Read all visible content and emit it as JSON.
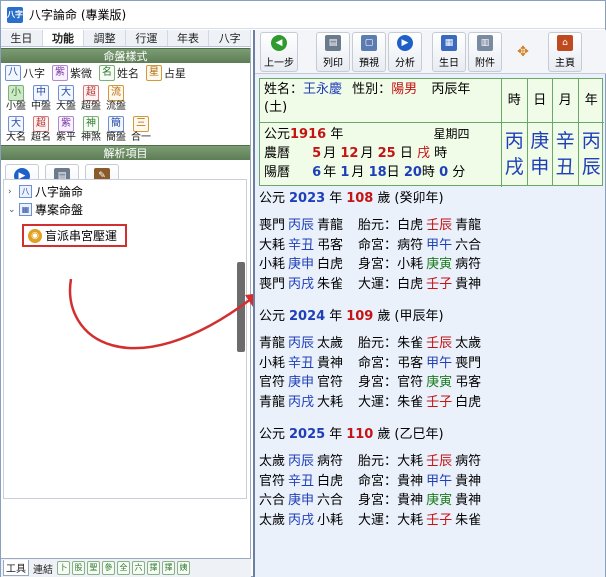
{
  "window": {
    "title": "八字論命 (專業版)",
    "icon_text": "八字"
  },
  "left_tabs": [
    "生日",
    "功能",
    "調整",
    "行運",
    "年表",
    "八字"
  ],
  "sections": {
    "chart_style": "命盤樣式",
    "analysis": "解析項目"
  },
  "style_row1": [
    {
      "icon": "八",
      "label": "八字"
    },
    {
      "icon": "紫",
      "label": "紫微"
    },
    {
      "icon": "名",
      "label": "姓名"
    },
    {
      "icon": "星",
      "label": "占星"
    }
  ],
  "style_row2": [
    {
      "icon": "小",
      "label": "小盤"
    },
    {
      "icon": "中",
      "label": "中盤"
    },
    {
      "icon": "大",
      "label": "大盤"
    },
    {
      "icon": "超",
      "label": "超盤"
    },
    {
      "icon": "流",
      "label": "流盤"
    }
  ],
  "style_row3": [
    {
      "icon": "大",
      "label": "大名"
    },
    {
      "icon": "超",
      "label": "超名"
    },
    {
      "icon": "紫",
      "label": "紫平"
    },
    {
      "icon": "神",
      "label": "神煞"
    },
    {
      "icon": "簡",
      "label": "簡盤"
    },
    {
      "icon": "三",
      "label": "合一"
    }
  ],
  "analysis_buttons": [
    "分析",
    "列印",
    "撰寫"
  ],
  "tree": {
    "root": "八字論命",
    "case": "專案命盤",
    "selected": "盲派串宮壓運"
  },
  "bottom_tabs": {
    "tools": "工具",
    "links": "連結",
    "minis": [
      "卜",
      "股",
      "聖",
      "參",
      "全",
      "六",
      "擇",
      "擇",
      "姨"
    ]
  },
  "toolbar": [
    "上一步",
    "列印",
    "預視",
    "分析",
    "生日",
    "附件",
    "",
    "主頁"
  ],
  "info": {
    "name_label": "姓名：",
    "name": "王永慶",
    "gender_label": "性別：",
    "gender": "陽男",
    "year_gz": "丙辰年",
    "year_wx": "(土)",
    "western_label": "公元",
    "western_year": "1916",
    "year_unit": "年",
    "weekday": "星期四",
    "lunar_label": "農曆",
    "lunar_month": "5",
    "lunar_day": "12",
    "lunar_hour": "25",
    "lunar_hour_unit": "日",
    "lunar_zhi": "戌",
    "hour_unit": "時",
    "solar_label": "陽曆",
    "solar_month": "6",
    "solar_day": "1",
    "solar_d2": "18",
    "solar_h": "20",
    "solar_m": "0",
    "pillars": [
      {
        "h": "時",
        "stem": "丙",
        "branch": "戌"
      },
      {
        "h": "日",
        "stem": "庚",
        "branch": "申"
      },
      {
        "h": "月",
        "stem": "辛",
        "branch": "丑"
      },
      {
        "h": "年",
        "stem": "丙",
        "branch": "辰"
      }
    ]
  },
  "years": [
    {
      "prefix": "公元",
      "year": "2023",
      "age": "108",
      "gz": "(癸卯年)",
      "rows": [
        [
          "喪門",
          "丙辰",
          "青龍",
          "胎元：",
          "白虎",
          "壬辰",
          "青龍"
        ],
        [
          "大耗",
          "辛丑",
          "弔客",
          "命宮：",
          "病符",
          "甲午",
          "六合"
        ],
        [
          "小耗",
          "庚申",
          "白虎",
          "身宮：",
          "小耗",
          "庚寅",
          "病符"
        ],
        [
          "喪門",
          "丙戌",
          "朱雀",
          "大運：",
          "白虎",
          "壬子",
          "貴神"
        ]
      ]
    },
    {
      "prefix": "公元",
      "year": "2024",
      "age": "109",
      "gz": "(甲辰年)",
      "rows": [
        [
          "青龍",
          "丙辰",
          "太歲",
          "胎元：",
          "朱雀",
          "壬辰",
          "太歲"
        ],
        [
          "小耗",
          "辛丑",
          "貴神",
          "命宮：",
          "弔客",
          "甲午",
          "喪門"
        ],
        [
          "官符",
          "庚申",
          "官符",
          "身宮：",
          "官符",
          "庚寅",
          "弔客"
        ],
        [
          "青龍",
          "丙戌",
          "大耗",
          "大運：",
          "朱雀",
          "壬子",
          "白虎"
        ]
      ]
    },
    {
      "prefix": "公元",
      "year": "2025",
      "age": "110",
      "gz": "(乙巳年)",
      "rows": [
        [
          "太歲",
          "丙辰",
          "病符",
          "胎元：",
          "大耗",
          "壬辰",
          "病符"
        ],
        [
          "官符",
          "辛丑",
          "白虎",
          "命宮：",
          "貴神",
          "甲午",
          "貴神"
        ],
        [
          "六合",
          "庚申",
          "六合",
          "身宮：",
          "貴神",
          "庚寅",
          "貴神"
        ],
        [
          "太歲",
          "丙戌",
          "小耗",
          "大運：",
          "大耗",
          "壬子",
          "朱雀"
        ]
      ]
    }
  ],
  "labels": {
    "year_unit": "年",
    "age_unit": "歲",
    "min_unit": "分",
    "day_unit": "日",
    "hour_unit": "時",
    "month_unit": "月"
  }
}
